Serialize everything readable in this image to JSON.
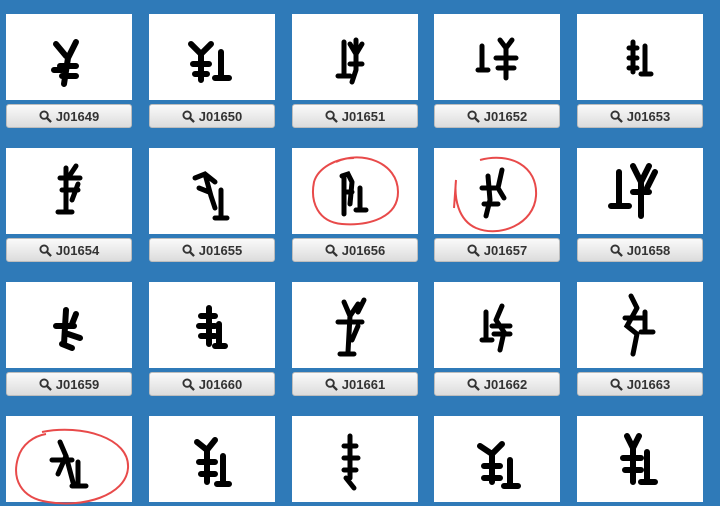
{
  "accent": "#2f7ab8",
  "circle_color": "#e84a4a",
  "items": [
    {
      "code": "J01649",
      "circled": false
    },
    {
      "code": "J01650",
      "circled": false
    },
    {
      "code": "J01651",
      "circled": false
    },
    {
      "code": "J01652",
      "circled": false
    },
    {
      "code": "J01653",
      "circled": false
    },
    {
      "code": "J01654",
      "circled": false
    },
    {
      "code": "J01655",
      "circled": false
    },
    {
      "code": "J01656",
      "circled": true
    },
    {
      "code": "J01657",
      "circled": true
    },
    {
      "code": "J01658",
      "circled": false
    },
    {
      "code": "J01659",
      "circled": false
    },
    {
      "code": "J01660",
      "circled": false
    },
    {
      "code": "J01661",
      "circled": false
    },
    {
      "code": "J01662",
      "circled": false
    },
    {
      "code": "J01663",
      "circled": false
    },
    {
      "code": "",
      "circled": true
    },
    {
      "code": "",
      "circled": false
    },
    {
      "code": "",
      "circled": false
    },
    {
      "code": "",
      "circled": false
    },
    {
      "code": "",
      "circled": false
    }
  ]
}
